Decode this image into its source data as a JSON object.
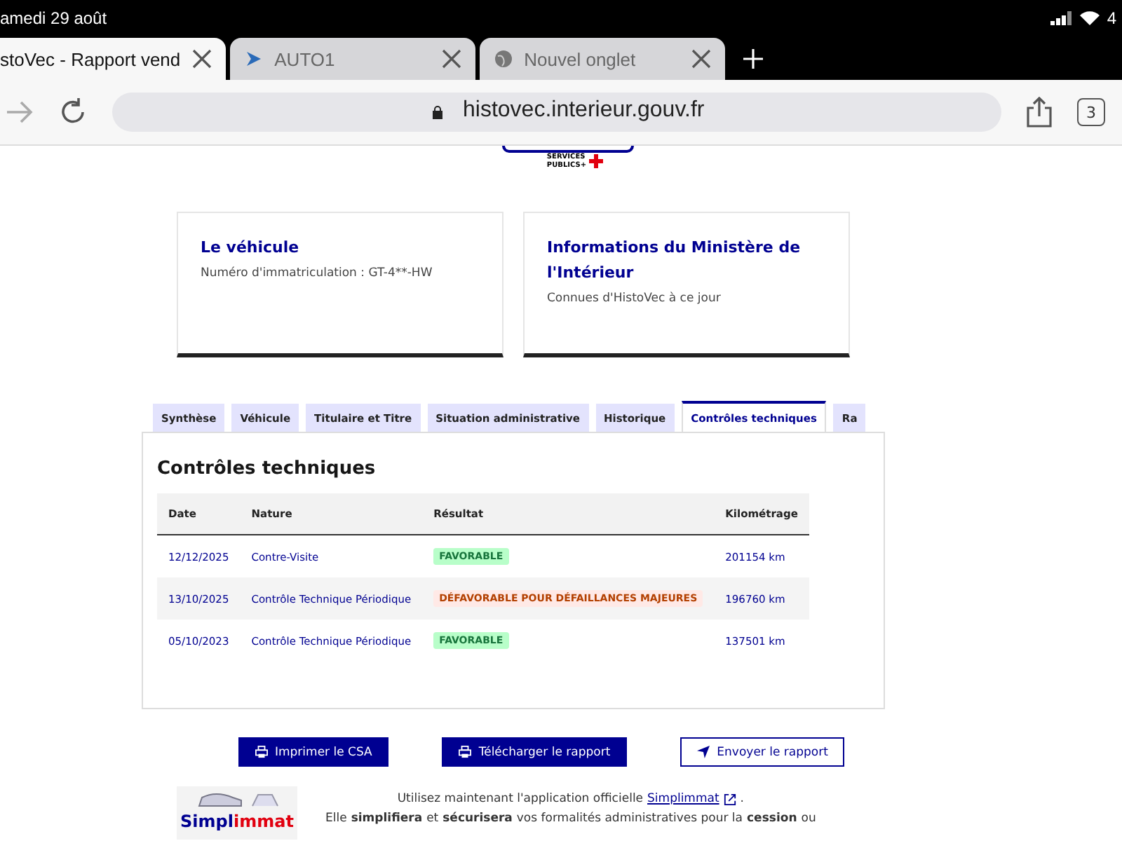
{
  "status_bar": {
    "date": "amedi 29 août",
    "battery": "4"
  },
  "browser_tabs": [
    {
      "title": "stoVec - Rapport vend",
      "selected": true,
      "kind": "page"
    },
    {
      "title": "AUTO1",
      "selected": false,
      "kind": "site"
    },
    {
      "title": "Nouvel onglet",
      "selected": false,
      "kind": "globe"
    }
  ],
  "address_bar": {
    "url": "histovec.interieur.gouv.fr",
    "tab_count": "3"
  },
  "logo": {
    "line_1": "SERVICES",
    "line_2": "PUBLICS+"
  },
  "cards": [
    {
      "title": "Le véhicule",
      "text": "Numéro d'immatriculation : GT-4**-HW"
    },
    {
      "title": "Informations du Ministère de l'Intérieur",
      "text": "Connues d'HistoVec à ce jour"
    }
  ],
  "tabs": [
    {
      "label": "Synthèse",
      "selected": false
    },
    {
      "label": "Véhicule",
      "selected": false
    },
    {
      "label": "Titulaire et Titre",
      "selected": false
    },
    {
      "label": "Situation administrative",
      "selected": false
    },
    {
      "label": "Historique",
      "selected": false
    },
    {
      "label": "Contrôles techniques",
      "selected": true
    },
    {
      "label": "Ra",
      "selected": false
    }
  ],
  "panel": {
    "title": "Contrôles techniques",
    "table": {
      "columns": [
        "Date",
        "Nature",
        "Résultat",
        "Kilométrage"
      ],
      "rows": [
        {
          "date": "12/12/2025",
          "nature": "Contre-Visite",
          "result": "FAVORABLE",
          "kind": "favorable",
          "km": "201154 km"
        },
        {
          "date": "13/10/2025",
          "nature": "Contrôle Technique Périodique",
          "result": "DÉFAVORABLE POUR DÉFAILLANCES MAJEURES",
          "kind": "unfavorable",
          "km": "196760 km"
        },
        {
          "date": "05/10/2023",
          "nature": "Contrôle Technique Périodique",
          "result": "FAVORABLE",
          "kind": "favorable",
          "km": "137501 km"
        }
      ]
    }
  },
  "buttons": [
    {
      "label": "Imprimer le CSA",
      "kind": "print"
    },
    {
      "label": "Télécharger le rapport",
      "kind": "print"
    },
    {
      "label": "Envoyer le rapport",
      "kind": "send"
    }
  ],
  "promo": {
    "logo_part_1": "Simpl",
    "logo_part_2": "immat",
    "line_1": "Utilisez maintenant l'application officielle",
    "link": "Simplimmat",
    "line_1_end": ".",
    "line_2": "Elle **simplifiera** et **sécurisera** vos formalités administratives pour la **cession** ou"
  }
}
